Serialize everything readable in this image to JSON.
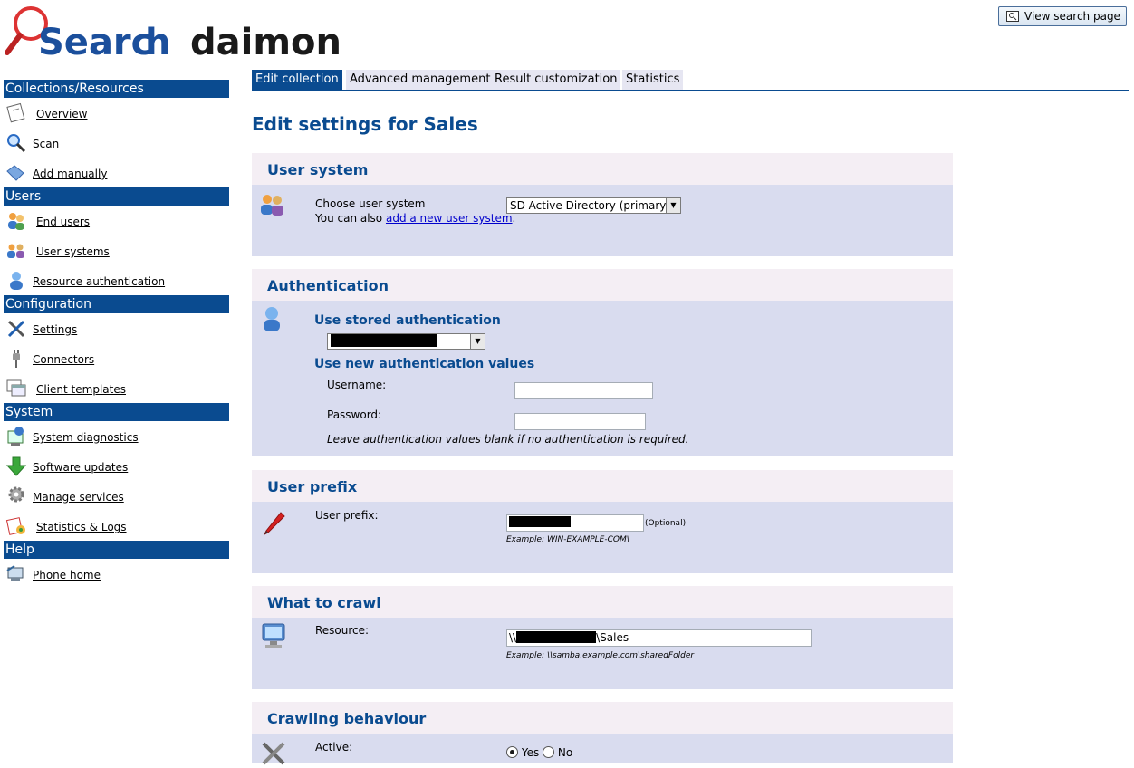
{
  "header": {
    "logo_text_left": "Searc",
    "logo_text_mid": "h",
    "logo_text_right": "daimon",
    "view_search_label": "View search page"
  },
  "sidebar": {
    "sections": [
      {
        "title": "Collections/Resources",
        "items": [
          {
            "label": "Overview",
            "icon": "document-icon"
          },
          {
            "label": "Scan",
            "icon": "magnifier-icon"
          },
          {
            "label": "Add manually",
            "icon": "tag-icon"
          }
        ]
      },
      {
        "title": "Users",
        "items": [
          {
            "label": "End users",
            "icon": "users-icon"
          },
          {
            "label": "User systems",
            "icon": "user-systems-icon"
          },
          {
            "label": "Resource authentication",
            "icon": "user-icon"
          }
        ]
      },
      {
        "title": "Configuration",
        "items": [
          {
            "label": "Settings",
            "icon": "tools-icon"
          },
          {
            "label": "Connectors",
            "icon": "plug-icon"
          },
          {
            "label": "Client templates",
            "icon": "windows-icon"
          }
        ]
      },
      {
        "title": "System",
        "items": [
          {
            "label": "System diagnostics",
            "icon": "diagnostics-icon"
          },
          {
            "label": "Software updates",
            "icon": "download-arrow-icon"
          },
          {
            "label": "Manage services",
            "icon": "gears-icon"
          },
          {
            "label": "Statistics & Logs",
            "icon": "statistics-icon"
          }
        ]
      },
      {
        "title": "Help",
        "items": [
          {
            "label": "Phone home",
            "icon": "phone-home-icon"
          }
        ]
      }
    ]
  },
  "tabs": [
    "Edit collection",
    "Advanced management",
    "Result customization",
    "Statistics"
  ],
  "active_tab": "Edit collection",
  "page_title": "Edit settings for Sales",
  "sections": {
    "user_system": {
      "title": "User system",
      "choose_label": "Choose user system",
      "selected": "SD Active Directory (primary)",
      "also_text": "You can also ",
      "also_link": "add a new user system",
      "also_end": "."
    },
    "authentication": {
      "title": "Authentication",
      "stored_label": "Use stored authentication",
      "new_label": "Use new authentication values",
      "username_label": "Username:",
      "password_label": "Password:",
      "hint": "Leave authentication values blank if no authentication is required."
    },
    "user_prefix": {
      "title": "User prefix",
      "label": "User prefix:",
      "optional": "(Optional)",
      "example": "Example: WIN-EXAMPLE-COM\\"
    },
    "what_to_crawl": {
      "title": "What to crawl",
      "label": "Resource:",
      "value_prefix": "\\\\",
      "value_suffix": "\\Sales",
      "example": "Example: \\\\samba.example.com\\sharedFolder"
    },
    "crawling": {
      "title": "Crawling behaviour",
      "active_label": "Active:",
      "yes": "Yes",
      "no": "No",
      "active_value": "Yes"
    }
  },
  "colors": {
    "brand": "#0a4b90",
    "section_bg": "#d9dcef",
    "section_head_bg": "#f4eef4"
  }
}
